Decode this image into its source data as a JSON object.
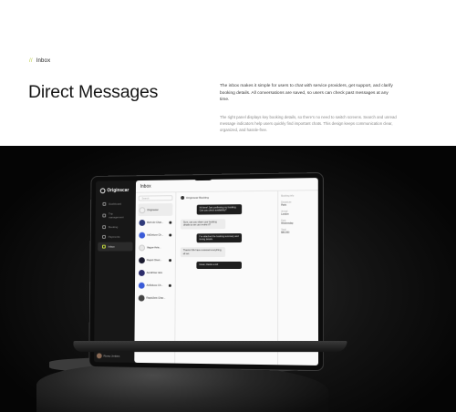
{
  "intro": {
    "eyebrow": "Inbox",
    "title": "Direct Messages",
    "description_primary": "The inbox makes it simple for users to chat with service providers, get support, and clarify booking details. All conversations are saved, so users can check past messages at any time.",
    "description_secondary": "The right panel displays key booking details, so there's no need to switch screens. Search and unread message indicators help users quickly find important chats. This design keeps communication clear, organized, and hassle-free."
  },
  "colors": {
    "accent": "#b6c93a",
    "hero_bg": "#0a0a0a"
  },
  "app": {
    "brand": "Originscar",
    "nav": [
      {
        "label": "Dashboard",
        "icon": "grid-icon"
      },
      {
        "label": "Trip management",
        "icon": "route-icon"
      },
      {
        "label": "Booking",
        "icon": "calendar-icon"
      },
      {
        "label": "Payments",
        "icon": "card-icon"
      },
      {
        "label": "Inbox",
        "icon": "inbox-icon",
        "active": true
      }
    ],
    "user_name": "Ronny Jenkins",
    "header_title": "Inbox",
    "search_placeholder": "Search",
    "chats": [
      {
        "name": "Originscar",
        "color": "#f1f1f1"
      },
      {
        "name": "Rich Air Char...",
        "color": "#2f3a7a"
      },
      {
        "name": "AirDeluxe Ch...",
        "color": "#3a5bd8"
      },
      {
        "name": "Vague Avia...",
        "color": "#e8e8e8"
      },
      {
        "name": "Rapid Chart...",
        "color": "#1a1a2e"
      },
      {
        "name": "AeroFlow Jets",
        "color": "#2d2d6b"
      },
      {
        "name": "AirDeluxe Ch...",
        "color": "#3a5bd8"
      },
      {
        "name": "RapidJets Char...",
        "color": "#444"
      }
    ],
    "conversation_title": "Originscar Booking",
    "messages": [
      {
        "type": "dark",
        "text": "Hi there! Just confirming my booking. Can you check availability?"
      },
      {
        "type": "light",
        "text": "Sure, can you share your booking details so we can review it?"
      },
      {
        "type": "dark",
        "text": "I've attached the booking summary and timing details."
      },
      {
        "type": "light",
        "text": "Thanks! We have reviewed everything, all set."
      },
      {
        "type": "dark",
        "text": "Great, thanks a lot!"
      }
    ],
    "details": [
      {
        "k": "Booking info",
        "v": ""
      },
      {
        "k": "Departure",
        "v": "Paris"
      },
      {
        "k": "Arrival",
        "v": "London"
      },
      {
        "k": "Date",
        "v": "Wednesday"
      },
      {
        "k": "Total",
        "v": "$60,000"
      }
    ]
  }
}
